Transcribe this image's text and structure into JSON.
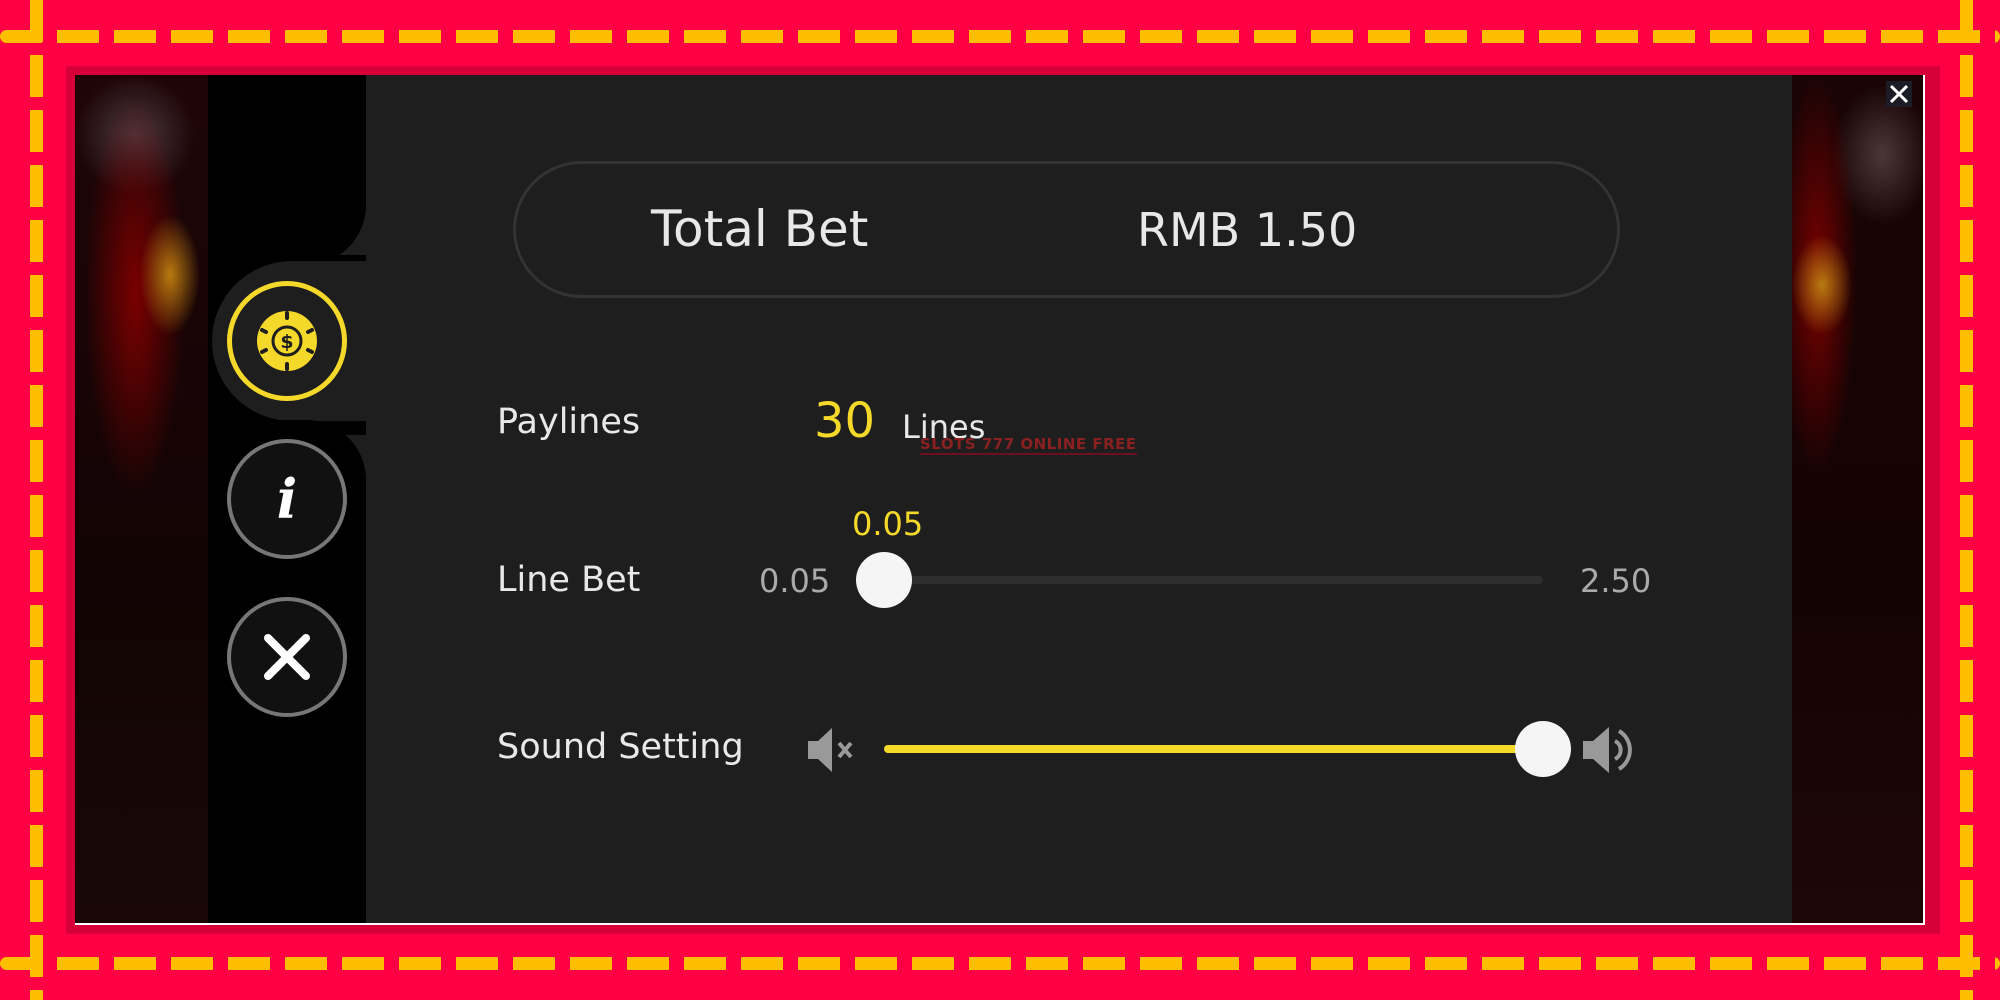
{
  "title_bar": {
    "close_icon": "close-icon"
  },
  "sidebar": {
    "items": [
      {
        "name": "bet-settings",
        "icon": "casino-chip-dollar-icon",
        "active": true
      },
      {
        "name": "info",
        "icon": "info-icon",
        "active": false
      },
      {
        "name": "close",
        "icon": "close-icon",
        "active": false
      }
    ]
  },
  "total_bet": {
    "label": "Total Bet",
    "value": "RMB 1.50"
  },
  "paylines": {
    "label": "Paylines",
    "value": "30",
    "unit": "Lines"
  },
  "line_bet": {
    "label": "Line Bet",
    "current": "0.05",
    "min": "0.05",
    "max": "2.50",
    "fraction": 0
  },
  "sound": {
    "label": "Sound Setting",
    "level_percent": 100,
    "mute_icon": "speaker-mute-icon",
    "max_icon": "speaker-loud-icon"
  },
  "watermark": "SLOTS 777 ONLINE FREE",
  "colors": {
    "accent": "#f5d92a",
    "frame": "#ff0044",
    "dashes": "#ffbf00",
    "panel": "#1e1e1e"
  }
}
